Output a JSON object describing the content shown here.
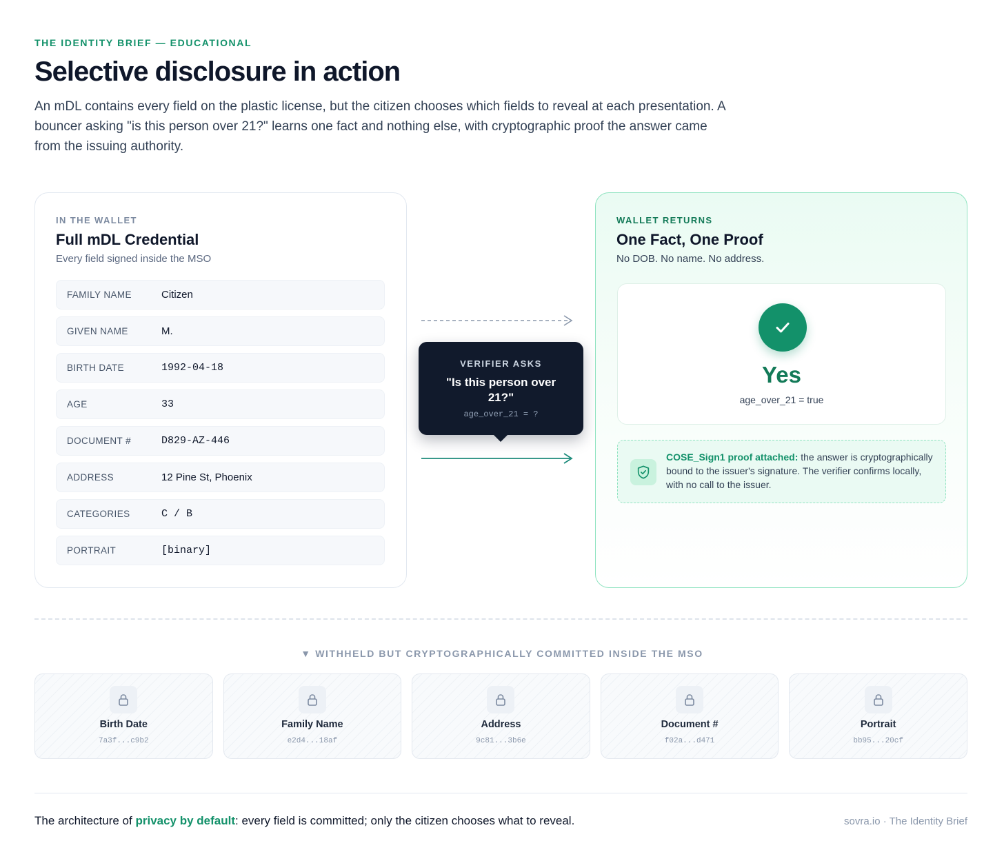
{
  "header": {
    "eyebrow": "THE IDENTITY BRIEF — EDUCATIONAL",
    "title": "Selective disclosure in action",
    "intro": "An mDL contains every field on the plastic license, but the citizen chooses which fields to reveal at each presentation. A bouncer asking \"is this person over 21?\" learns one fact and nothing else, with cryptographic proof the answer came from the issuing authority."
  },
  "wallet": {
    "eyebrow": "IN THE WALLET",
    "title": "Full mDL Credential",
    "subtitle": "Every field signed inside the MSO",
    "fields": [
      {
        "label": "FAMILY NAME",
        "value": "Citizen"
      },
      {
        "label": "GIVEN NAME",
        "value": "M."
      },
      {
        "label": "BIRTH DATE",
        "value": "1992-04-18"
      },
      {
        "label": "AGE",
        "value": "33"
      },
      {
        "label": "DOCUMENT #",
        "value": "D829-AZ-446"
      },
      {
        "label": "ADDRESS",
        "value": "12 Pine St, Phoenix"
      },
      {
        "label": "CATEGORIES",
        "value": "C / B"
      },
      {
        "label": "PORTRAIT",
        "value": "[binary]"
      }
    ]
  },
  "verifier": {
    "eyebrow": "VERIFIER ASKS",
    "question": "\"Is this person over 21?\"",
    "code": "age_over_21 = ?"
  },
  "result": {
    "eyebrow": "WALLET RETURNS",
    "title": "One Fact, One Proof",
    "subtitle": "No DOB. No name. No address.",
    "answer": "Yes",
    "answer_code": "age_over_21 = true",
    "proof_strong": "COSE_Sign1 proof attached:",
    "proof_text": " the answer is cryptographically bound to the issuer's signature. The verifier confirms locally, with no call to the issuer."
  },
  "withheld": {
    "title": "▼ WITHHELD BUT CRYPTOGRAPHICALLY COMMITTED INSIDE THE MSO",
    "items": [
      {
        "label": "Birth Date",
        "hash": "7a3f...c9b2"
      },
      {
        "label": "Family Name",
        "hash": "e2d4...18af"
      },
      {
        "label": "Address",
        "hash": "9c81...3b6e"
      },
      {
        "label": "Document #",
        "hash": "f02a...d471"
      },
      {
        "label": "Portrait",
        "hash": "bb95...20cf"
      }
    ]
  },
  "footer": {
    "prefix": "The architecture of ",
    "accent": "privacy by default",
    "suffix": ": every field is committed; only the citizen chooses what to reveal.",
    "credit": "sovra.io · The Identity Brief"
  },
  "colors": {
    "accent_green": "#13916a",
    "dark_navy": "#111a2c",
    "mint_border": "#8fe3c0"
  },
  "icons": {
    "check": "check-icon",
    "shield": "shield-check-icon",
    "lock": "lock-icon",
    "arrow": "arrow-right-icon"
  }
}
